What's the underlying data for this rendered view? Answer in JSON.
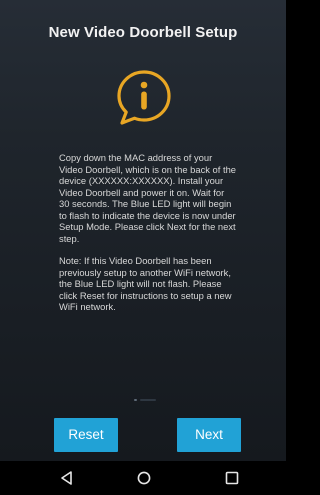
{
  "header": {
    "title": "New Video Doorbell Setup"
  },
  "info_icon": {
    "name": "info-icon",
    "color": "#e8a624"
  },
  "instructions": {
    "paragraph1": "Copy down the MAC address of your Video Doorbell, which is on the back of the device (XXXXXX:XXXXXX). Install your Video Doorbell and power it on. Wait for 30 seconds. The Blue LED light will begin to flash to indicate the device is now under Setup Mode. Please click Next for the next step.",
    "paragraph2": "Note: If this Video Doorbell has been previously setup to another WiFi network, the Blue LED light will not flash. Please click Reset for instructions to setup a new WiFi network."
  },
  "buttons": {
    "reset_label": "Reset",
    "next_label": "Next",
    "color": "#21a2d6"
  },
  "navbar": {
    "back_icon": "back-triangle-icon",
    "home_icon": "home-circle-icon",
    "recent_icon": "recent-apps-square-icon"
  }
}
